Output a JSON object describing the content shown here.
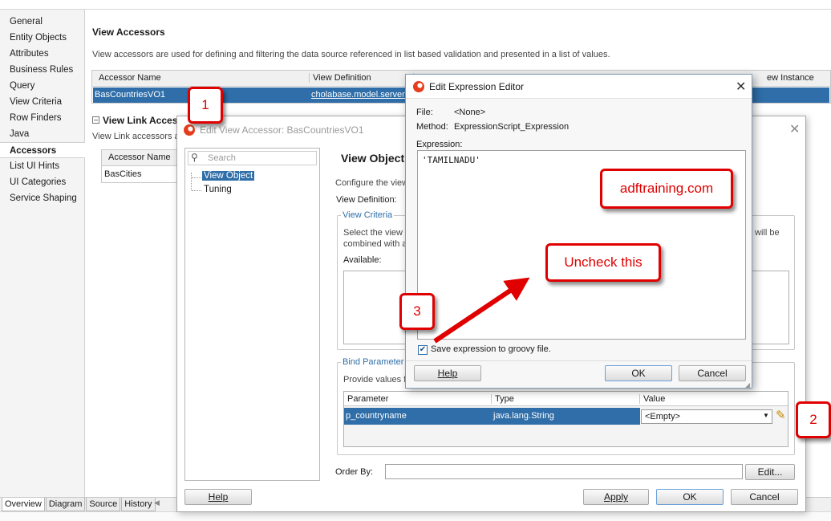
{
  "left_nav": {
    "items": [
      {
        "label": "General"
      },
      {
        "label": "Entity Objects"
      },
      {
        "label": "Attributes"
      },
      {
        "label": "Business Rules"
      },
      {
        "label": "Query"
      },
      {
        "label": "View Criteria"
      },
      {
        "label": "Row Finders"
      },
      {
        "label": "Java"
      },
      {
        "label": "Accessors",
        "selected": true
      },
      {
        "label": "List UI Hints"
      },
      {
        "label": "UI Categories"
      },
      {
        "label": "Service Shaping"
      }
    ]
  },
  "main": {
    "view_accessors_title": "View Accessors",
    "view_accessors_desc": "View accessors are used for defining and filtering the data source referenced in list based validation and presented in a list of values.",
    "accessor_table": {
      "headers": [
        "Accessor Name",
        "View Definition",
        "ew Instance"
      ],
      "row": {
        "name": "BasCountriesVO1",
        "definition": "cholabase.model.server."
      }
    },
    "view_link_title": "View Link Accessors",
    "view_link_desc": "View Link accessors ar",
    "link_table": {
      "headers": [
        "Accessor Name"
      ],
      "row": {
        "name": "BasCities"
      }
    }
  },
  "bottom_tabs": [
    "Overview",
    "Diagram",
    "Source",
    "History"
  ],
  "edit_view_accessor": {
    "title": "Edit View Accessor: BasCountriesVO1",
    "search_placeholder": "Search",
    "tree": [
      {
        "label": "View Object",
        "selected": true
      },
      {
        "label": "Tuning"
      }
    ],
    "heading": "View Object",
    "configure_text": "Configure the view",
    "view_definition_label": "View Definition:",
    "view_criteria_legend": "View Criteria",
    "view_criteria_text1": "Select the view",
    "view_criteria_text2": "combined with a",
    "view_criteria_right": "will be",
    "available_label": "Available:",
    "bind_legend": "Bind Parameter V",
    "bind_text": "Provide values f",
    "bind_table": {
      "headers": [
        "Parameter",
        "Type",
        "Value"
      ],
      "row": {
        "parameter": "p_countryname",
        "type": "java.lang.String",
        "value": "<Empty>"
      }
    },
    "order_by_label": "Order By:",
    "buttons": {
      "edit": "Edit...",
      "help": "Help",
      "apply": "Apply",
      "ok": "OK",
      "cancel": "Cancel"
    }
  },
  "expression_editor": {
    "title": "Edit Expression Editor",
    "file_label": "File:",
    "file_value": "<None>",
    "method_label": "Method:",
    "method_value": "ExpressionScript_Expression",
    "expression_label": "Expression:",
    "expression_value": "'TAMILNADU'",
    "checkbox_label": "Save expression to groovy file.",
    "checkbox_checked": true,
    "buttons": {
      "help": "Help",
      "ok": "OK",
      "cancel": "Cancel"
    }
  },
  "annotations": {
    "step1": "1",
    "step2": "2",
    "step3": "3",
    "brand": "adftraining.com",
    "uncheck": "Uncheck this"
  },
  "colors": {
    "selection": "#2f6ea8",
    "annotation_red": "#e00000",
    "link": "#003399"
  }
}
